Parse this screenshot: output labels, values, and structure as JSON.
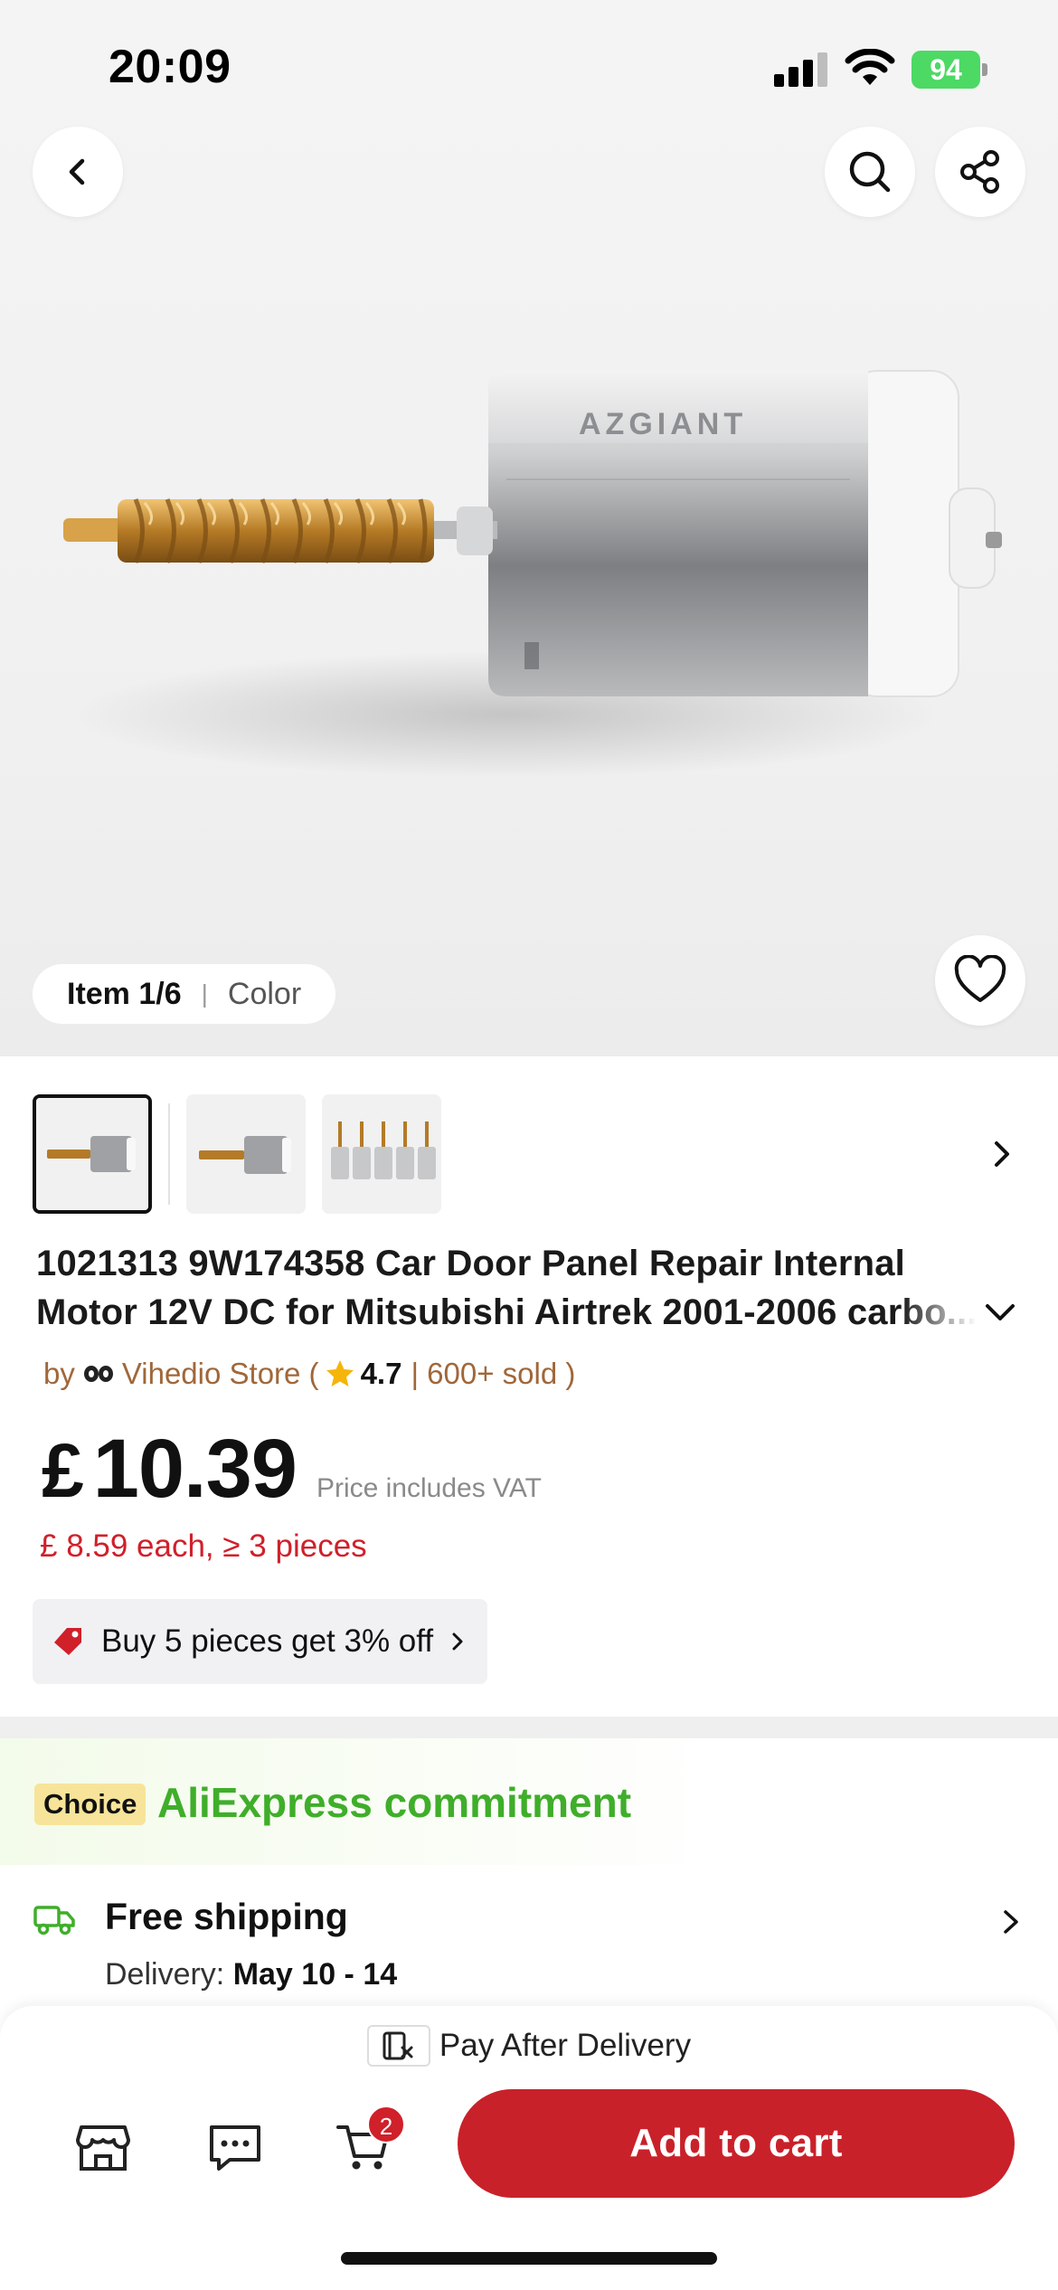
{
  "status_bar": {
    "time": "20:09",
    "battery": "94"
  },
  "hero": {
    "brand_on_product": "AZGIANT",
    "item_label": "Item 1/6",
    "item_variant": "Color"
  },
  "product": {
    "title_line1": "1021313 9W174358 Car Door Panel Repair Internal",
    "title_line2": "Motor 12V DC for Mitsubishi Airtrek 2001-2006 carbo...",
    "store_prefix": "by",
    "store_name": "Vihedio Store (",
    "rating": "4.7",
    "sold": "| 600+ sold )",
    "price_currency": "£",
    "price_value": "10.39",
    "price_note": "Price includes VAT",
    "bulk_price": "£ 8.59 each, ≥ 3 pieces",
    "promo": "Buy 5 pieces get 3% off"
  },
  "choice": {
    "badge": "Choice",
    "title": "AliExpress commitment"
  },
  "shipping": {
    "title": "Free shipping",
    "delivery_label": "Delivery:",
    "delivery_dates": "May 10 - 14"
  },
  "bottom_bar": {
    "pay_after": "Pay After Delivery",
    "cart_count": "2",
    "add_to_cart": "Add to cart"
  },
  "colors": {
    "accent_red": "#c9212a",
    "price_red": "#d0202a",
    "choice_green": "#3fae2a",
    "store_brown": "#a0673a",
    "choice_badge": "#f7e49a"
  },
  "icons": [
    "chevron-left-icon",
    "search-icon",
    "share-icon",
    "heart-icon",
    "chevron-right-icon",
    "chevron-down-icon",
    "star-icon",
    "tag-icon",
    "truck-icon",
    "store-icon",
    "message-icon",
    "cart-icon",
    "pay-after-delivery-icon"
  ]
}
